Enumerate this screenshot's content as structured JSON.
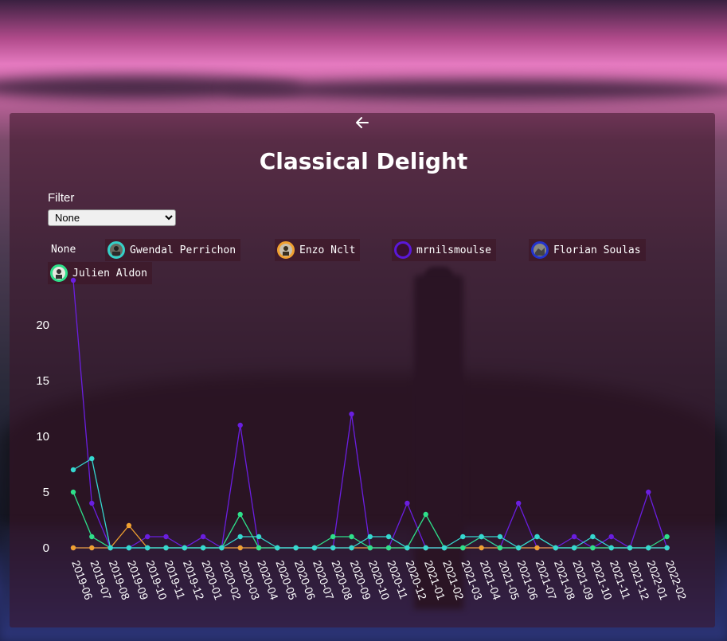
{
  "header": {
    "title": "Classical Delight",
    "back_icon": "arrow-left-icon"
  },
  "filter": {
    "label": "Filter",
    "selected": "None"
  },
  "users": [
    {
      "name": "None"
    },
    {
      "name": "Gwendal Perrichon",
      "color": "#35d0c8"
    },
    {
      "name": "Enzo Nclt",
      "color": "#f0a030"
    },
    {
      "name": "mrnilsmoulse",
      "color": "#5a18d8"
    },
    {
      "name": "Florian Soulas",
      "color": "#2233cc"
    },
    {
      "name": "Julien Aldon",
      "color": "#2ee08a"
    }
  ],
  "chart_data": {
    "type": "line",
    "categories": [
      "2019-06",
      "2019-07",
      "2019-08",
      "2019-09",
      "2019-10",
      "2019-11",
      "2019-12",
      "2020-01",
      "2020-02",
      "2020-03",
      "2020-04",
      "2020-05",
      "2020-06",
      "2020-07",
      "2020-08",
      "2020-09",
      "2020-10",
      "2020-11",
      "2020-12",
      "2021-01",
      "2021-02",
      "2021-03",
      "2021-04",
      "2021-05",
      "2021-06",
      "2021-07",
      "2021-08",
      "2021-09",
      "2021-10",
      "2021-11",
      "2021-12",
      "2022-01",
      "2022-02"
    ],
    "yticks": [
      0,
      5,
      10,
      15,
      20
    ],
    "ylim": [
      0,
      23
    ],
    "series": [
      {
        "name": "mrnilsmoulse",
        "color": "#6a1ee0",
        "values": [
          24,
          4,
          0,
          0,
          1,
          1,
          0,
          1,
          0,
          11,
          0,
          0,
          0,
          0,
          0,
          12,
          0,
          0,
          4,
          0,
          0,
          0,
          1,
          0,
          4,
          0,
          0,
          1,
          0,
          1,
          0,
          5,
          0
        ]
      },
      {
        "name": "Florian Soulas",
        "color": "#2a2ad0",
        "values": [
          0,
          0,
          0,
          0,
          0,
          0,
          0,
          0,
          0,
          0,
          0,
          0,
          0,
          0,
          0,
          0,
          0,
          0,
          0,
          0,
          0,
          0,
          0,
          0,
          0,
          0,
          0,
          0,
          0,
          0,
          0,
          0,
          0
        ]
      },
      {
        "name": "Enzo Nclt",
        "color": "#f0a030",
        "values": [
          0,
          0,
          0,
          2,
          0,
          0,
          0,
          0,
          0,
          0,
          0,
          0,
          0,
          0,
          0,
          0,
          0,
          0,
          0,
          0,
          0,
          0,
          0,
          0,
          0,
          0,
          0,
          0,
          0,
          0,
          0,
          0,
          0
        ]
      },
      {
        "name": "Julien Aldon",
        "color": "#2ee08a",
        "values": [
          5,
          1,
          0,
          0,
          0,
          0,
          0,
          0,
          0,
          3,
          0,
          0,
          0,
          0,
          1,
          1,
          0,
          0,
          0,
          3,
          0,
          0,
          1,
          0,
          0,
          1,
          0,
          0,
          0,
          0,
          0,
          0,
          1
        ]
      },
      {
        "name": "Gwendal Perrichon",
        "color": "#35d8d0",
        "values": [
          7,
          8,
          0,
          0,
          0,
          0,
          0,
          0,
          0,
          1,
          1,
          0,
          0,
          0,
          0,
          0,
          1,
          1,
          0,
          0,
          0,
          1,
          1,
          1,
          0,
          1,
          0,
          0,
          1,
          0,
          0,
          0,
          0
        ]
      }
    ]
  }
}
